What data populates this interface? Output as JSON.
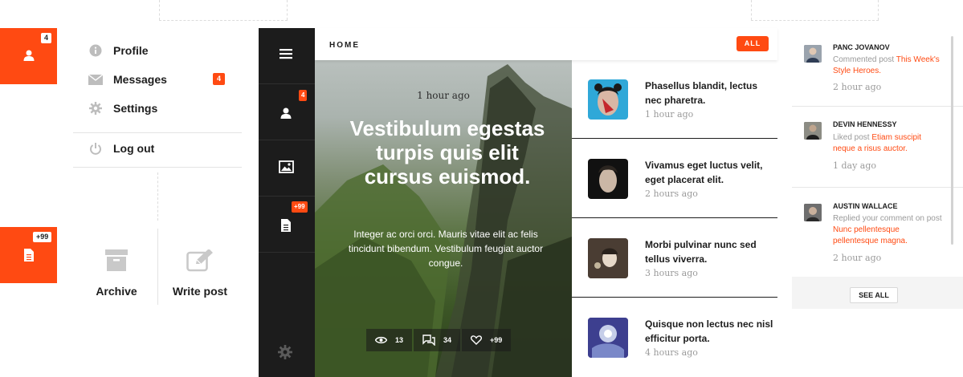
{
  "tiles": [
    {
      "badge": "4",
      "icon": "user-icon"
    },
    {
      "badge": "+99",
      "icon": "document-icon"
    }
  ],
  "dropdown": {
    "items": [
      {
        "label": "Profile",
        "icon": "info-icon"
      },
      {
        "label": "Messages",
        "icon": "envelope-icon",
        "badge": "4"
      },
      {
        "label": "Settings",
        "icon": "gear-icon"
      },
      {
        "label": "Log out",
        "icon": "power-icon"
      }
    ]
  },
  "actions": [
    {
      "label": "Archive",
      "icon": "archive-icon"
    },
    {
      "label": "Write post",
      "icon": "edit-icon"
    }
  ],
  "sidebar": {
    "user_badge": "4",
    "docs_badge": "+99"
  },
  "header": {
    "title": "HOME",
    "filter": "ALL"
  },
  "hero": {
    "time": "1 hour ago",
    "headline": "Vestibulum egestas turpis quis elit cursus euismod.",
    "body": "Integer ac orci orci. Mauris vitae elit ac felis tincidunt bibendum. Vestibulum feugiat auctor congue.",
    "views": "13",
    "comments": "34",
    "likes": "+99"
  },
  "posts": [
    {
      "title": "Phasellus blandit, lectus nec pharetra.",
      "time": "1 hour ago"
    },
    {
      "title": "Vivamus eget luctus velit, eget placerat elit.",
      "time": "2 hours ago"
    },
    {
      "title": "Morbi pulvinar nunc sed tellus viverra.",
      "time": "3 hours ago"
    },
    {
      "title": "Quisque non lectus nec nisl efficitur porta.",
      "time": "4 hours ago"
    }
  ],
  "activity": [
    {
      "name": "PANC JOVANOV",
      "action": "Commented post",
      "target": "This Week's Style Heroes.",
      "time": "2 hour ago"
    },
    {
      "name": "DEVIN HENNESSY",
      "action": "Liked post",
      "target": "Etiam suscipit neque a risus auctor.",
      "time": "1 day ago"
    },
    {
      "name": "AUSTIN WALLACE",
      "action": "Replied your comment on post",
      "target": "Nunc pellentesque pellentesque magna.",
      "time": "2 hour ago"
    }
  ],
  "see_all": "SEE ALL",
  "colors": {
    "accent": "#ff4a12",
    "dark": "#1c1c1c"
  }
}
